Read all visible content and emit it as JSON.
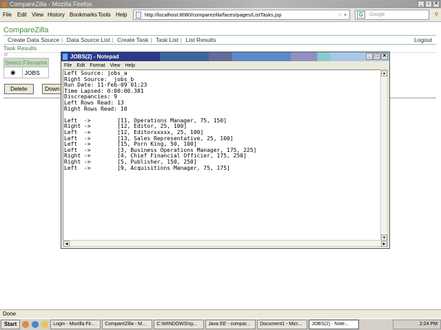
{
  "browser": {
    "title": "CompareZilla - Mozilla Firefox",
    "menu": [
      "File",
      "Edit",
      "View",
      "History",
      "Bookmarks",
      "Tools",
      "Help"
    ],
    "url": "http://localhost:8080/comparezilla/faces/pages/ListTasks.jsp",
    "search_placeholder": "Google",
    "status": "Done"
  },
  "page": {
    "brand": "CompareZilla",
    "nav": [
      "Create Data Source",
      "Data Source List",
      "Create Task",
      "Task List",
      "List Results"
    ],
    "logout": "Logout",
    "section": "Task Results",
    "table": {
      "headers": [
        "Select",
        "Filename"
      ],
      "rows": [
        {
          "filename": "JOBS",
          "selected": true
        }
      ]
    },
    "buttons": {
      "delete": "Delete",
      "download": "Down"
    }
  },
  "notepad": {
    "title": "JOBS(2) - Notepad",
    "menu": [
      "File",
      "Edit",
      "Format",
      "View",
      "Help"
    ],
    "lines": [
      "Left Source: jobs_a",
      "Right Source:  jobs_b",
      "Run Date: 11-Feb-09 01:23",
      "Time Lapsed: 0:00:00.381",
      "Discrepancies: 9",
      "Left Rows Read: 13",
      "Right Rows Read: 10",
      "",
      "Left  ->        [11, Operations Manager, 75, 150]",
      "Right ->        [12, Editor, 25, 100]",
      "Left  ->        [12, Editorxxxxx, 25, 100]",
      "Left  ->        [13, Sales Representative, 25, 100]",
      "Left  ->        [15, Porn King, 50, 100]",
      "Left  ->        [3, Business Operations Manager, 175, 225]",
      "Right ->        [4, Chief Financial Officier, 175, 250]",
      "Right ->        [5, Publisher, 150, 250]",
      "Left  ->        [9, Acquisitions Manager, 75, 175]"
    ]
  },
  "taskbar": {
    "start": "Start",
    "tasks": [
      "Login - Mozilla Fir...",
      "CompareZilla - M...",
      "C:\\WINDOWS\\sy...",
      "Java EE - compar...",
      "Document1 - Micr...",
      "JOBS(2) - Note..."
    ],
    "active": 5,
    "clock": "2:24 PM"
  }
}
